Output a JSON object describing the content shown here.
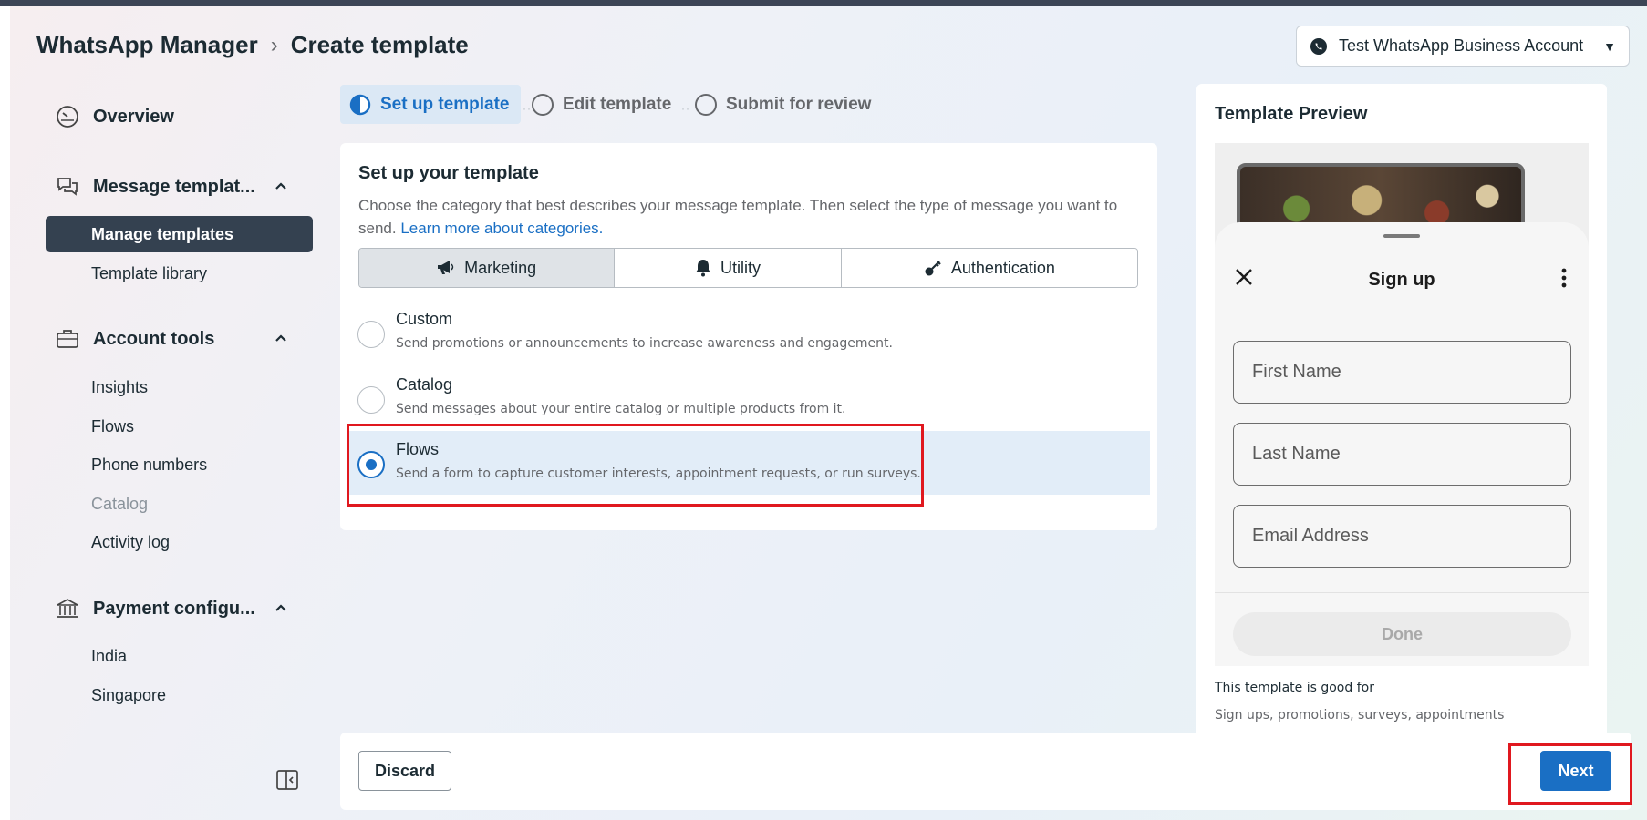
{
  "header": {
    "breadcrumb_root": "WhatsApp Manager",
    "breadcrumb_current": "Create template",
    "account_label": "Test WhatsApp Business Account"
  },
  "sidebar": {
    "overview": "Overview",
    "message_templates": "Message templat...",
    "manage_templates": "Manage templates",
    "template_library": "Template library",
    "account_tools": "Account tools",
    "insights": "Insights",
    "flows": "Flows",
    "phone_numbers": "Phone numbers",
    "catalog": "Catalog",
    "activity_log": "Activity log",
    "payment_config": "Payment configu...",
    "india": "India",
    "singapore": "Singapore"
  },
  "stepper": {
    "step1": "Set up template",
    "step2": "Edit template",
    "step3": "Submit for review"
  },
  "setup": {
    "title": "Set up your template",
    "description": "Choose the category that best describes your message template. Then select the type of message you want to send.",
    "learn_more": "Learn more about categories.",
    "categories": [
      "Marketing",
      "Utility",
      "Authentication"
    ],
    "selected_category": "Marketing",
    "options": [
      {
        "title": "Custom",
        "desc": "Send promotions or announcements to increase awareness and engagement."
      },
      {
        "title": "Catalog",
        "desc": "Send messages about your entire catalog or multiple products from it."
      },
      {
        "title": "Flows",
        "desc": "Send a form to capture customer interests, appointment requests, or run surveys."
      }
    ],
    "selected_option": "Flows"
  },
  "preview": {
    "title": "Template Preview",
    "sheet_title": "Sign up",
    "fields": [
      "First Name",
      "Last Name",
      "Email Address"
    ],
    "done_label": "Done",
    "good_for_label": "This template is good for",
    "good_for_value": "Sign ups, promotions, surveys, appointments"
  },
  "footer": {
    "discard": "Discard",
    "next": "Next"
  },
  "colors": {
    "accent": "#1a6fc4",
    "highlight": "#e0181f",
    "sidebar_active": "#344150"
  }
}
